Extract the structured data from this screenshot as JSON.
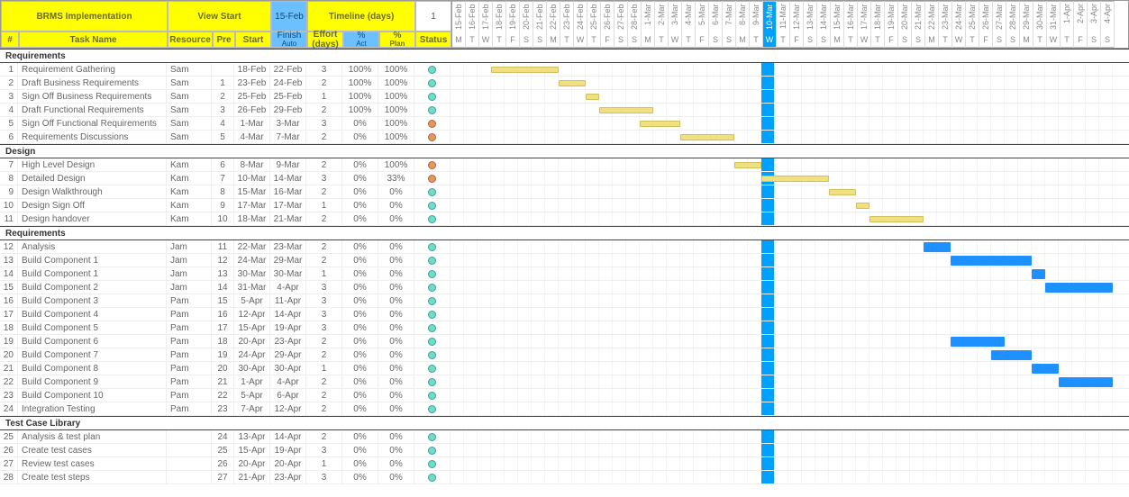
{
  "project_title": "BRMS Implementation",
  "view_start_label": "View Start",
  "view_start_date": "15-Feb",
  "timeline_label": "Timeline (days)",
  "timeline_value": "1",
  "columns": {
    "num": "#",
    "task": "Task Name",
    "resource": "Resource",
    "pre": "Pre",
    "start": "Start",
    "finish": "Finish",
    "finish_sub": "Auto",
    "effort": "Effort (days)",
    "pct_act": "%",
    "pct_act_sub": "Act",
    "pct_plan": "%",
    "pct_plan_sub": "Plan",
    "status": "Status"
  },
  "dates": [
    {
      "d": "15-Feb",
      "w": "M"
    },
    {
      "d": "16-Feb",
      "w": "T"
    },
    {
      "d": "17-Feb",
      "w": "W"
    },
    {
      "d": "18-Feb",
      "w": "T"
    },
    {
      "d": "19-Feb",
      "w": "F"
    },
    {
      "d": "20-Feb",
      "w": "S"
    },
    {
      "d": "21-Feb",
      "w": "S"
    },
    {
      "d": "22-Feb",
      "w": "M"
    },
    {
      "d": "23-Feb",
      "w": "T"
    },
    {
      "d": "24-Feb",
      "w": "W"
    },
    {
      "d": "25-Feb",
      "w": "T"
    },
    {
      "d": "26-Feb",
      "w": "F"
    },
    {
      "d": "27-Feb",
      "w": "S"
    },
    {
      "d": "28-Feb",
      "w": "S"
    },
    {
      "d": "1-Mar",
      "w": "M"
    },
    {
      "d": "2-Mar",
      "w": "T"
    },
    {
      "d": "3-Mar",
      "w": "W"
    },
    {
      "d": "4-Mar",
      "w": "T"
    },
    {
      "d": "5-Mar",
      "w": "F"
    },
    {
      "d": "6-Mar",
      "w": "S"
    },
    {
      "d": "7-Mar",
      "w": "S"
    },
    {
      "d": "8-Mar",
      "w": "M"
    },
    {
      "d": "9-Mar",
      "w": "T"
    },
    {
      "d": "10-Mar",
      "w": "W",
      "today": true
    },
    {
      "d": "11-Mar",
      "w": "T"
    },
    {
      "d": "12-Mar",
      "w": "F"
    },
    {
      "d": "13-Mar",
      "w": "S"
    },
    {
      "d": "14-Mar",
      "w": "S"
    },
    {
      "d": "15-Mar",
      "w": "M"
    },
    {
      "d": "16-Mar",
      "w": "T"
    },
    {
      "d": "17-Mar",
      "w": "W"
    },
    {
      "d": "18-Mar",
      "w": "T"
    },
    {
      "d": "19-Mar",
      "w": "F"
    },
    {
      "d": "20-Mar",
      "w": "S"
    },
    {
      "d": "21-Mar",
      "w": "S"
    },
    {
      "d": "22-Mar",
      "w": "M"
    },
    {
      "d": "23-Mar",
      "w": "T"
    },
    {
      "d": "24-Mar",
      "w": "W"
    },
    {
      "d": "25-Mar",
      "w": "T"
    },
    {
      "d": "26-Mar",
      "w": "F"
    },
    {
      "d": "27-Mar",
      "w": "S"
    },
    {
      "d": "28-Mar",
      "w": "S"
    },
    {
      "d": "29-Mar",
      "w": "M"
    },
    {
      "d": "30-Mar",
      "w": "T"
    },
    {
      "d": "31-Mar",
      "w": "W"
    },
    {
      "d": "1-Apr",
      "w": "T"
    },
    {
      "d": "2-Apr",
      "w": "F"
    },
    {
      "d": "3-Apr",
      "w": "S"
    },
    {
      "d": "4-Apr",
      "w": "S"
    }
  ],
  "sections": [
    {
      "name": "Requirements",
      "tasks": [
        {
          "n": "1",
          "name": "Requirement Gathering",
          "res": "Sam",
          "pre": "",
          "start": "18-Feb",
          "finish": "22-Feb",
          "eff": "3",
          "act": "100%",
          "plan": "100%",
          "status": "green",
          "bar": {
            "s": 3,
            "e": 7,
            "cls": "done"
          }
        },
        {
          "n": "2",
          "name": "Draft Business Requirements",
          "res": "Sam",
          "pre": "1",
          "start": "23-Feb",
          "finish": "24-Feb",
          "eff": "2",
          "act": "100%",
          "plan": "100%",
          "status": "green",
          "bar": {
            "s": 8,
            "e": 9,
            "cls": "done"
          }
        },
        {
          "n": "3",
          "name": "Sign Off Business Requirements",
          "res": "Sam",
          "pre": "2",
          "start": "25-Feb",
          "finish": "25-Feb",
          "eff": "1",
          "act": "100%",
          "plan": "100%",
          "status": "green",
          "bar": {
            "s": 10,
            "e": 10,
            "cls": "done"
          }
        },
        {
          "n": "4",
          "name": "Draft Functional Requirements",
          "res": "Sam",
          "pre": "3",
          "start": "26-Feb",
          "finish": "29-Feb",
          "eff": "2",
          "act": "100%",
          "plan": "100%",
          "status": "green",
          "bar": {
            "s": 11,
            "e": 14,
            "cls": "done"
          }
        },
        {
          "n": "5",
          "name": "Sign Off Functional Requirements",
          "res": "Sam",
          "pre": "4",
          "start": "1-Mar",
          "finish": "3-Mar",
          "eff": "3",
          "act": "0%",
          "plan": "100%",
          "status": "orange",
          "bar": {
            "s": 14,
            "e": 16,
            "cls": "done"
          }
        },
        {
          "n": "6",
          "name": "Requirements Discussions",
          "res": "Sam",
          "pre": "5",
          "start": "4-Mar",
          "finish": "7-Mar",
          "eff": "2",
          "act": "0%",
          "plan": "100%",
          "status": "orange",
          "bar": {
            "s": 17,
            "e": 20,
            "cls": "done"
          }
        }
      ]
    },
    {
      "name": "Design",
      "tasks": [
        {
          "n": "7",
          "name": "High Level Design",
          "res": "Kam",
          "pre": "6",
          "start": "8-Mar",
          "finish": "9-Mar",
          "eff": "2",
          "act": "0%",
          "plan": "100%",
          "status": "orange",
          "bar": {
            "s": 21,
            "e": 22,
            "cls": "pend"
          }
        },
        {
          "n": "8",
          "name": "Detailed Design",
          "res": "Kam",
          "pre": "7",
          "start": "10-Mar",
          "finish": "14-Mar",
          "eff": "3",
          "act": "0%",
          "plan": "33%",
          "status": "orange",
          "bar": {
            "s": 23,
            "e": 27,
            "cls": "pend"
          }
        },
        {
          "n": "9",
          "name": "Design Walkthrough",
          "res": "Kam",
          "pre": "8",
          "start": "15-Mar",
          "finish": "16-Mar",
          "eff": "2",
          "act": "0%",
          "plan": "0%",
          "status": "green",
          "bar": {
            "s": 28,
            "e": 29,
            "cls": "pend"
          }
        },
        {
          "n": "10",
          "name": "Design Sign Off",
          "res": "Kam",
          "pre": "9",
          "start": "17-Mar",
          "finish": "17-Mar",
          "eff": "1",
          "act": "0%",
          "plan": "0%",
          "status": "green",
          "bar": {
            "s": 30,
            "e": 30,
            "cls": "pend"
          }
        },
        {
          "n": "11",
          "name": "Design handover",
          "res": "Kam",
          "pre": "10",
          "start": "18-Mar",
          "finish": "21-Mar",
          "eff": "2",
          "act": "0%",
          "plan": "0%",
          "status": "green",
          "bar": {
            "s": 31,
            "e": 34,
            "cls": "pend"
          }
        }
      ]
    },
    {
      "name": "Requirements",
      "tasks": [
        {
          "n": "12",
          "name": "Analysis",
          "res": "Jam",
          "pre": "11",
          "start": "22-Mar",
          "finish": "23-Mar",
          "eff": "2",
          "act": "0%",
          "plan": "0%",
          "status": "green",
          "bar": {
            "s": 35,
            "e": 36,
            "cls": "blue"
          }
        },
        {
          "n": "13",
          "name": "Build Component 1",
          "res": "Jam",
          "pre": "12",
          "start": "24-Mar",
          "finish": "29-Mar",
          "eff": "2",
          "act": "0%",
          "plan": "0%",
          "status": "green",
          "bar": {
            "s": 37,
            "e": 42,
            "cls": "blue"
          }
        },
        {
          "n": "14",
          "name": "Build Component 1",
          "res": "Jam",
          "pre": "13",
          "start": "30-Mar",
          "finish": "30-Mar",
          "eff": "1",
          "act": "0%",
          "plan": "0%",
          "status": "green",
          "bar": {
            "s": 43,
            "e": 43,
            "cls": "blue"
          }
        },
        {
          "n": "15",
          "name": "Build Component 2",
          "res": "Jam",
          "pre": "14",
          "start": "31-Mar",
          "finish": "4-Apr",
          "eff": "3",
          "act": "0%",
          "plan": "0%",
          "status": "green",
          "bar": {
            "s": 44,
            "e": 48,
            "cls": "blue"
          }
        },
        {
          "n": "16",
          "name": "Build Component 3",
          "res": "Pam",
          "pre": "15",
          "start": "5-Apr",
          "finish": "11-Apr",
          "eff": "3",
          "act": "0%",
          "plan": "0%",
          "status": "green"
        },
        {
          "n": "17",
          "name": "Build Component 4",
          "res": "Pam",
          "pre": "16",
          "start": "12-Apr",
          "finish": "14-Apr",
          "eff": "3",
          "act": "0%",
          "plan": "0%",
          "status": "green"
        },
        {
          "n": "18",
          "name": "Build Component 5",
          "res": "Pam",
          "pre": "17",
          "start": "15-Apr",
          "finish": "19-Apr",
          "eff": "3",
          "act": "0%",
          "plan": "0%",
          "status": "green"
        },
        {
          "n": "19",
          "name": "Build Component 6",
          "res": "Pam",
          "pre": "18",
          "start": "20-Apr",
          "finish": "23-Apr",
          "eff": "2",
          "act": "0%",
          "plan": "0%",
          "status": "green",
          "bar": {
            "s": 37,
            "e": 40,
            "cls": "blue"
          }
        },
        {
          "n": "20",
          "name": "Build Component 7",
          "res": "Pam",
          "pre": "19",
          "start": "24-Apr",
          "finish": "29-Apr",
          "eff": "2",
          "act": "0%",
          "plan": "0%",
          "status": "green",
          "bar": {
            "s": 40,
            "e": 42,
            "cls": "blue"
          }
        },
        {
          "n": "21",
          "name": "Build Component 8",
          "res": "Pam",
          "pre": "20",
          "start": "30-Apr",
          "finish": "30-Apr",
          "eff": "1",
          "act": "0%",
          "plan": "0%",
          "status": "green",
          "bar": {
            "s": 43,
            "e": 44,
            "cls": "blue"
          }
        },
        {
          "n": "22",
          "name": "Build Component 9",
          "res": "Pam",
          "pre": "21",
          "start": "1-Apr",
          "finish": "4-Apr",
          "eff": "2",
          "act": "0%",
          "plan": "0%",
          "status": "green",
          "bar": {
            "s": 45,
            "e": 48,
            "cls": "blue"
          }
        },
        {
          "n": "23",
          "name": "Build Component 10",
          "res": "Pam",
          "pre": "22",
          "start": "5-Apr",
          "finish": "6-Apr",
          "eff": "2",
          "act": "0%",
          "plan": "0%",
          "status": "green"
        },
        {
          "n": "24",
          "name": "Integration Testing",
          "res": "Pam",
          "pre": "23",
          "start": "7-Apr",
          "finish": "12-Apr",
          "eff": "2",
          "act": "0%",
          "plan": "0%",
          "status": "green"
        }
      ]
    },
    {
      "name": "Test Case Library",
      "tasks": [
        {
          "n": "25",
          "name": "Analysis & test plan",
          "res": "",
          "pre": "24",
          "start": "13-Apr",
          "finish": "14-Apr",
          "eff": "2",
          "act": "0%",
          "plan": "0%",
          "status": "green"
        },
        {
          "n": "26",
          "name": "Create test cases",
          "res": "",
          "pre": "25",
          "start": "15-Apr",
          "finish": "19-Apr",
          "eff": "3",
          "act": "0%",
          "plan": "0%",
          "status": "green"
        },
        {
          "n": "27",
          "name": "Review test cases",
          "res": "",
          "pre": "26",
          "start": "20-Apr",
          "finish": "20-Apr",
          "eff": "1",
          "act": "0%",
          "plan": "0%",
          "status": "green"
        },
        {
          "n": "28",
          "name": "Create test steps",
          "res": "",
          "pre": "27",
          "start": "21-Apr",
          "finish": "23-Apr",
          "eff": "3",
          "act": "0%",
          "plan": "0%",
          "status": "green"
        }
      ]
    }
  ]
}
